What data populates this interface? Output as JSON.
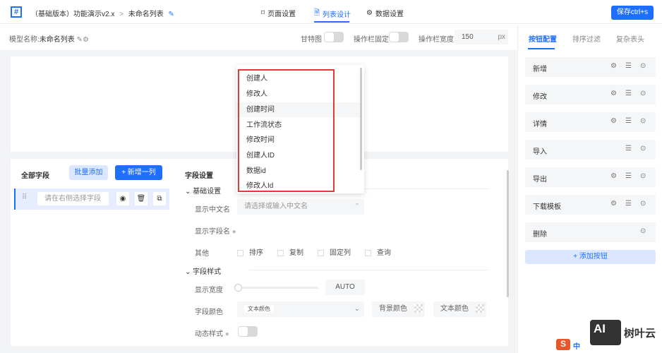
{
  "header": {
    "logo": "#",
    "breadcrumb_parent": "（基础版本）功能演示v2.x",
    "separator": ">",
    "breadcrumb_current": "未命名列表",
    "tabs": [
      {
        "label": "页面设置",
        "icon": "bookmark-icon"
      },
      {
        "label": "列表设计",
        "icon": "document-icon",
        "active": true
      },
      {
        "label": "数据设置",
        "icon": "gear-icon"
      }
    ],
    "save_label": "保存ctrl+s"
  },
  "toolbar": {
    "model_label": "模型名称:",
    "model_name": "未命名列表",
    "gantt_label": "甘特图",
    "gantt_on": false,
    "fixed_label": "操作栏固定",
    "fixed_on": false,
    "width_label": "操作栏宽度",
    "width_value": "150",
    "width_unit": "px"
  },
  "fields": {
    "title": "全部字段",
    "batch_add": "批量添加",
    "add_column": "+ 新增一列",
    "item_placeholder": "请在右侧选择字段"
  },
  "settings": {
    "title": "字段设置",
    "basic_section": "基础设置",
    "cn_name_label": "显示中文名",
    "cn_name_placeholder": "请选择或输入中文名",
    "field_name_label": "显示字段名",
    "other_label": "其他",
    "checkboxes": [
      "排序",
      "复制",
      "固定列",
      "查询"
    ],
    "style_section": "字段样式",
    "width_label": "显示宽度",
    "width_value": "AUTO",
    "width_fraction": 0,
    "color_label": "字段颜色",
    "color_tag": "文本颜色",
    "bg_color": "背景颜色",
    "text_color": "文本颜色",
    "dynamic_label": "动态样式",
    "dynamic_on": false
  },
  "dropdown": {
    "options": [
      "创建人",
      "修改人",
      "创建时间",
      "工作流状态",
      "修改时间",
      "创建人ID",
      "数据id",
      "修改人Id"
    ],
    "hovered": "创建时间"
  },
  "right": {
    "tabs": [
      "按钮配置",
      "排序过滤",
      "复杂表头"
    ],
    "active_tab": "按钮配置",
    "buttons": [
      {
        "label": "新增",
        "gear": true
      },
      {
        "label": "修改",
        "gear": true
      },
      {
        "label": "详情",
        "gear": true
      },
      {
        "label": "导入",
        "gear": false
      },
      {
        "label": "导出",
        "gear": true
      },
      {
        "label": "下载模板",
        "gear": true
      },
      {
        "label": "删除",
        "gear": false,
        "sort": false
      }
    ],
    "add_button": "+ 添加按钮"
  },
  "watermark": {
    "logo": "AI",
    "brand": "树叶云",
    "ime": "中"
  },
  "colors": {
    "primary": "#1e6fff",
    "highlight": "#e53935"
  }
}
